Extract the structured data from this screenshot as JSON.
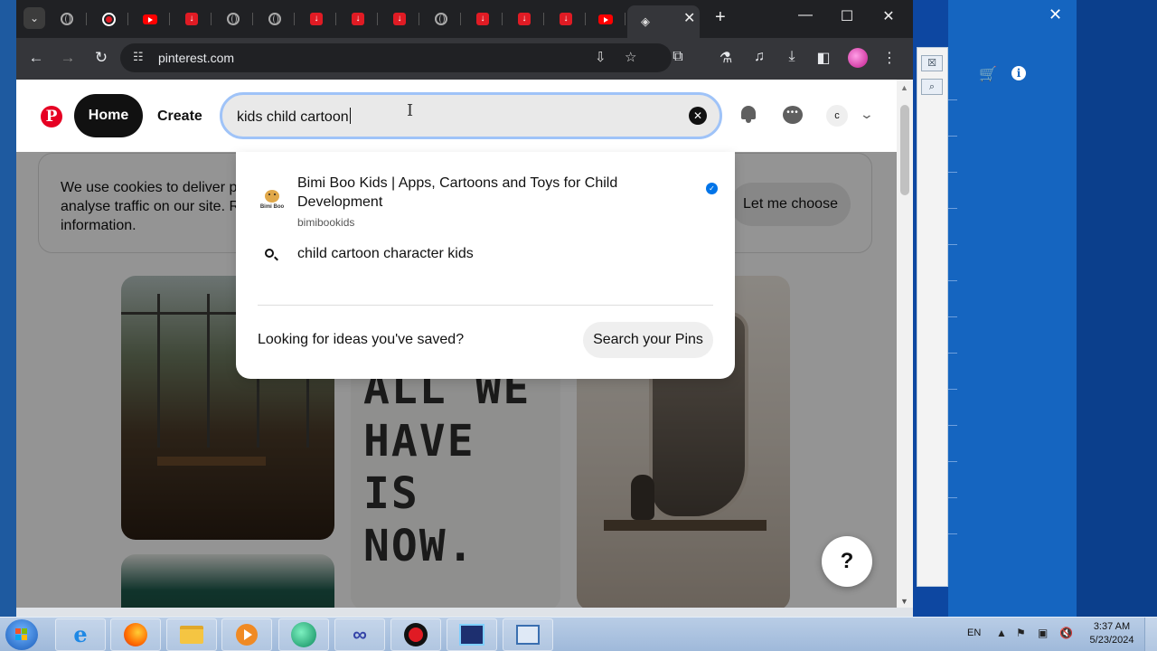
{
  "browser": {
    "url": "pinterest.com",
    "tab_close": "✕",
    "new_tab": "+"
  },
  "pinterest": {
    "logo": "P",
    "home_label": "Home",
    "create_label": "Create",
    "search_value": "kids child cartoon",
    "avatar_initial": "c",
    "cookie_text": "We use cookies to deliver p analyse traffic on our site. R information.",
    "cookie_button": "Let me choose",
    "quote_text": "ALL WE HAVE IS NOW.",
    "help": "?"
  },
  "dropdown": {
    "profile_title": "Bimi Boo Kids | Apps, Cartoons and Toys for Child Development",
    "profile_username": "bimibookids",
    "profile_logo_text": "Bimi Boo",
    "query_suggestion": "child cartoon character kids",
    "looking_text": "Looking for ideas you've saved?",
    "search_pins_button": "Search your Pins"
  },
  "taskbar": {
    "lang": "EN",
    "time": "3:37 AM",
    "date": "5/23/2024"
  },
  "icons": [
    "tab-search-icon",
    "youtube-icon",
    "download-icon",
    "globe-icon",
    "record-icon",
    "back-icon",
    "forward-icon",
    "reload-icon",
    "site-info-icon",
    "install-icon",
    "bookmark-star-icon",
    "extensions-icon",
    "labs-icon",
    "media-icon",
    "downloads-icon",
    "sidepanel-icon",
    "menu-icon",
    "bell-icon",
    "messages-icon",
    "chevron-down-icon",
    "search-icon",
    "clear-icon",
    "verified-icon"
  ]
}
